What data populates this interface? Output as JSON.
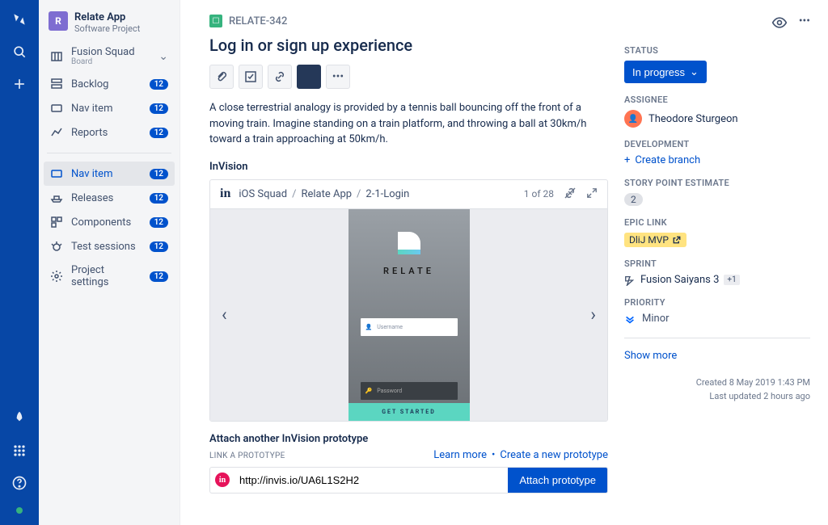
{
  "project": {
    "name": "Relate App",
    "type": "Software Project",
    "initial": "R"
  },
  "sidebar": {
    "items": [
      {
        "label": "Fusion Squad",
        "sub": "Board",
        "expand": true
      },
      {
        "label": "Backlog",
        "badge": "12"
      },
      {
        "label": "Nav item",
        "badge": "12"
      },
      {
        "label": "Reports",
        "badge": "12"
      }
    ],
    "items2": [
      {
        "label": "Nav item",
        "badge": "12",
        "active": true
      },
      {
        "label": "Releases",
        "badge": "12"
      },
      {
        "label": "Components",
        "badge": "12"
      },
      {
        "label": "Test sessions",
        "badge": "12"
      },
      {
        "label": "Project settings",
        "badge": "12"
      }
    ]
  },
  "issue": {
    "key": "RELATE-342",
    "title": "Log in or sign up experience",
    "description": "A close terrestrial analogy is provided by a tennis ball bouncing off the front of a moving train. Imagine standing on a train platform, and throwing a ball at 30km/h toward a train approaching at 50km/h.",
    "invision_heading": "InVision",
    "attach_heading": "Attach another InVision prototype",
    "link_label": "LINK A PROTOTYPE",
    "learn": "Learn more",
    "create": "Create a new prototype",
    "url": "http://invis.io/UA6L1S2H2",
    "attach_btn": "Attach prototype"
  },
  "invision": {
    "crumbs": [
      "iOS Squad",
      "Relate App",
      "2-1-Login"
    ],
    "counter": "1 of 28",
    "mock": {
      "brand": "RELATE",
      "f1": "Username",
      "f2": "Password",
      "cta": "GET STARTED"
    }
  },
  "details": {
    "status_label": "STATUS",
    "status": "In progress",
    "assignee_label": "ASSIGNEE",
    "assignee": "Theodore Sturgeon",
    "dev_label": "DEVELOPMENT",
    "dev_action": "Create branch",
    "sp_label": "STORY POINT ESTIMATE",
    "sp": "2",
    "epic_label": "EPIC LINK",
    "epic": "DliJ MVP",
    "sprint_label": "SPRINT",
    "sprint": "Fusion Saiyans 3",
    "sprint_more": "+1",
    "prio_label": "PRIORITY",
    "prio": "Minor",
    "showmore": "Show more",
    "created": "Created 8 May 2019 1:43 PM",
    "updated": "Last updated 2 hours ago"
  }
}
